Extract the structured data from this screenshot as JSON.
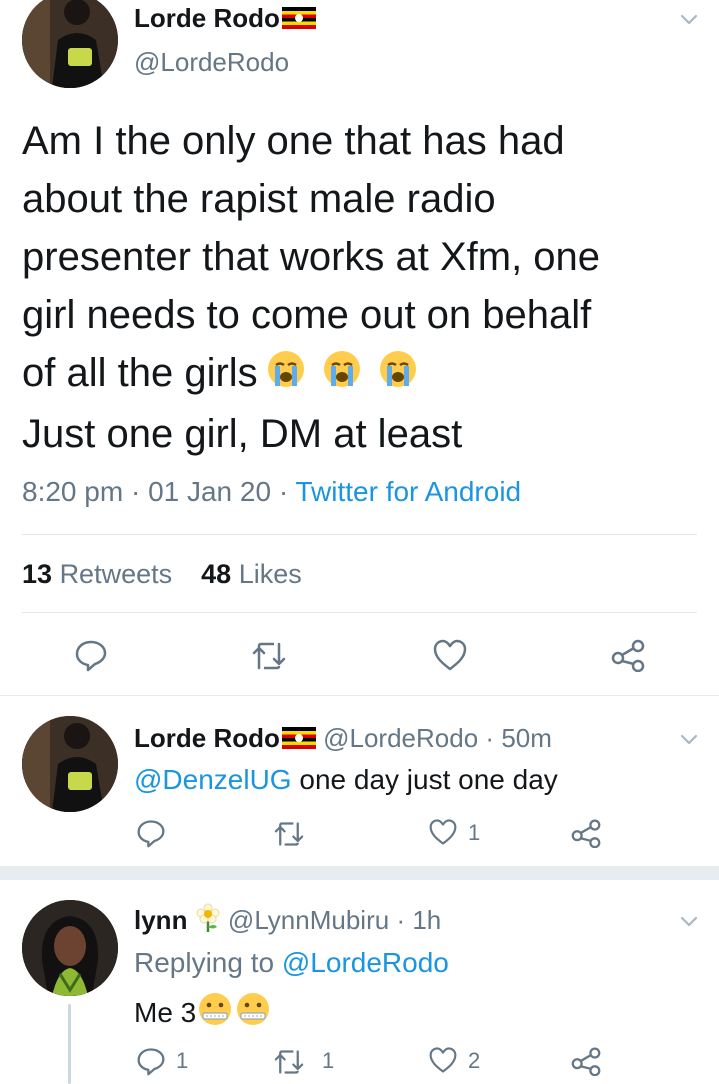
{
  "main_tweet": {
    "display_name": "Lorde Rodo",
    "handle": "@LordeRodo",
    "text_lines": [
      "Am I the only one that has had",
      "about the rapist male radio",
      "presenter that works at Xfm, one",
      "girl needs to come out on behalf",
      "of all the girls",
      "Just one girl, DM at least"
    ],
    "time": "8:20 pm",
    "sep1": "·",
    "date": "01 Jan 20",
    "sep2": "·",
    "source": "Twitter for Android",
    "retweets_count": "13",
    "retweets_label": "Retweets",
    "likes_count": "48",
    "likes_label": "Likes"
  },
  "replies": [
    {
      "display_name": "Lorde Rodo",
      "handle": "@LordeRodo",
      "sep": "·",
      "age": "50m",
      "mention": "@DenzelUG",
      "text": "one day just one day",
      "reply_count": "",
      "retweet_count": "",
      "like_count": "1"
    },
    {
      "display_name": "lynn",
      "handle": "@LynnMubiru",
      "sep": "·",
      "age": "1h",
      "replying_prefix": "Replying to",
      "replying_to": "@LordeRodo",
      "text": "Me 3",
      "reply_count": "1",
      "retweet_count": "1",
      "like_count": "2"
    }
  ],
  "colors": {
    "link": "#1b95e0",
    "muted": "#657786",
    "divider": "#e1e8ed"
  },
  "icons": {
    "reply": "reply-icon",
    "retweet": "retweet-icon",
    "like": "heart-icon",
    "share": "share-icon",
    "menu": "chevron-down-icon",
    "flag": "uganda-flag-icon",
    "crying": "loudly-crying-face-icon",
    "sick": "face-with-thermometer-icon",
    "flower": "blossom-icon"
  }
}
